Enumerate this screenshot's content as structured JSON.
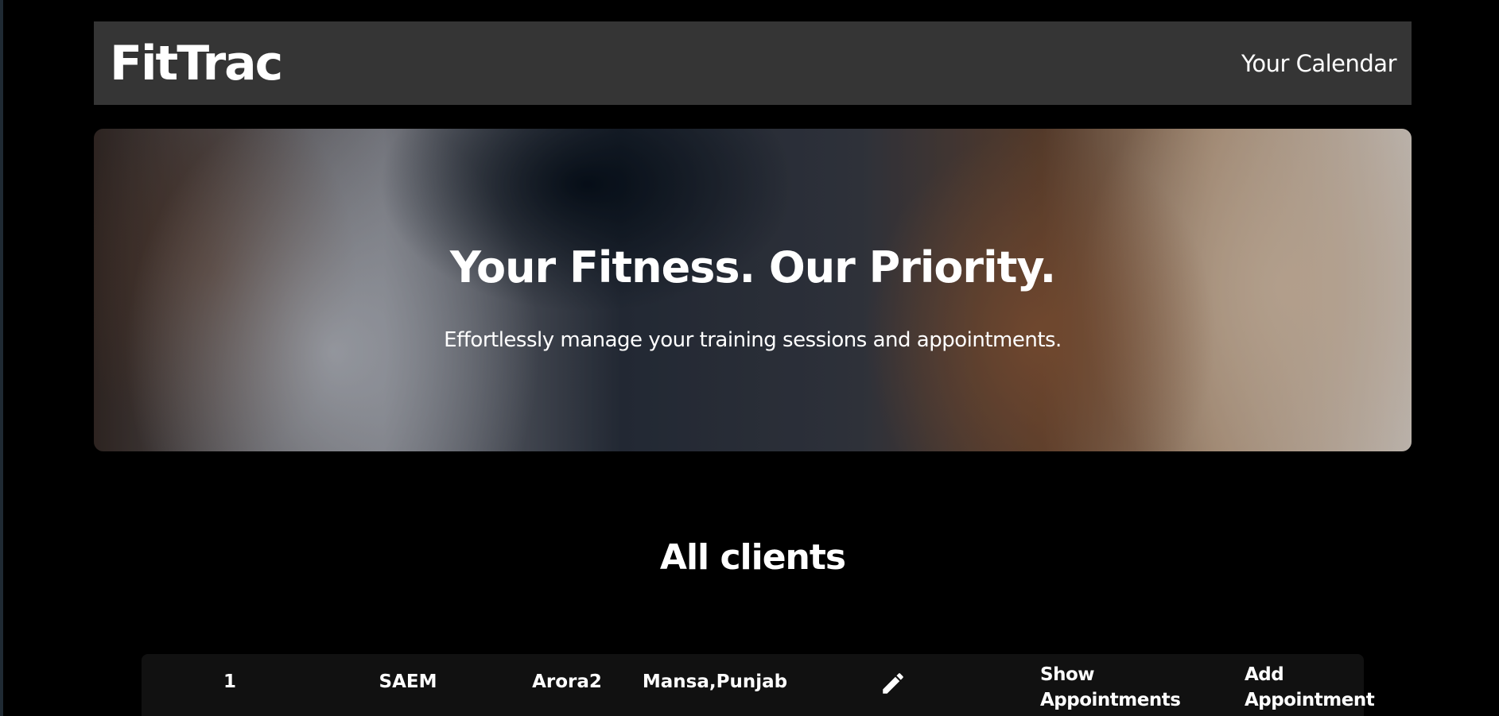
{
  "header": {
    "brand": "FitTrac",
    "nav_link": "Your Calendar"
  },
  "hero": {
    "title": "Your Fitness. Our Priority.",
    "subtitle": "Effortlessly manage your training sessions and appointments."
  },
  "clients_section": {
    "title": "All clients",
    "rows": [
      {
        "id": "1",
        "first_name": "SAEM",
        "last_name": "Arora2",
        "location": "Mansa,Punjab",
        "edit_icon": "pencil-icon",
        "show_appointments_label": "Show Appointments",
        "add_appointment_label": "Add Appointment"
      }
    ]
  },
  "colors": {
    "background": "#000000",
    "navbar": "#353535",
    "row_background": "#111111",
    "text": "#ffffff"
  }
}
